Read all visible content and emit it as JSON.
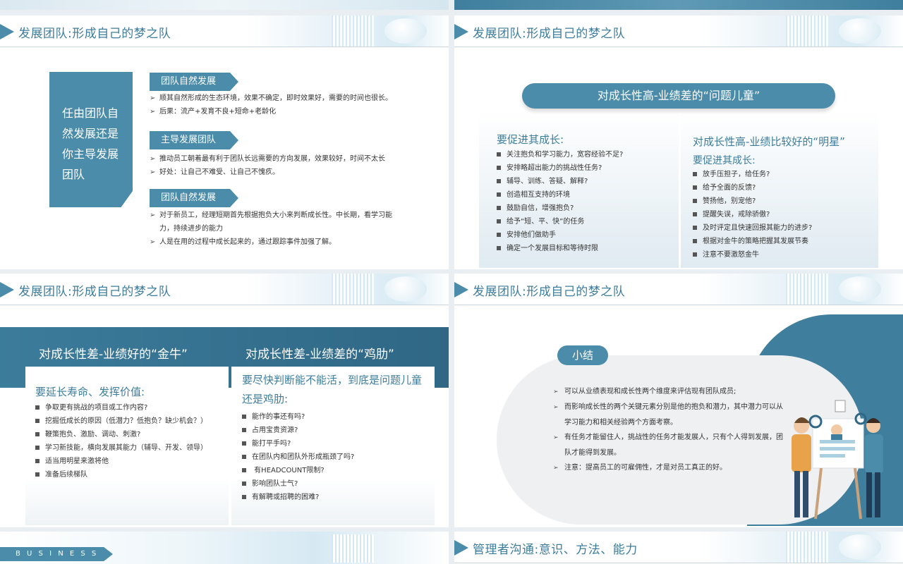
{
  "header_title": "发展团队:形成自己的梦之队",
  "slide1": {
    "left_box": "任由团队自然发展还是你主导发展团队",
    "sections": [
      {
        "tag": "团队自然发展",
        "bullets": [
          "顺其自然形成的生态环境，效果不确定，即时效果好，需要的时间也很长。",
          "后果：流产+发育不良+短命+老龄化"
        ]
      },
      {
        "tag": "主导发展团队",
        "bullets": [
          "推动员工朝着最有利于团队长远需要的方向发展，效果较好，时间不太长",
          "好处：让自己不难受、让自己不愧疚。"
        ]
      },
      {
        "tag": "团队自然发展",
        "bullets": [
          "对于新员工，经理短期首先根据抱负大小来判断成长性。中长期，看学习能力，持续进步的能力",
          "人是在用的过程中成长起来的，通过跟踪事件加强了解。"
        ]
      }
    ]
  },
  "slide2": {
    "pill": "对成长性高-业绩差的“问题儿童”",
    "left": {
      "sub": "要促进其成长:",
      "items": [
        "关注抱负和学习能力，宽容经验不足?",
        "安排略超出能力的挑战性任务?",
        "辅导、训练、答疑、解释?",
        "创造相互支持的环境",
        "鼓励自信，增强抱负?",
        "给予“短、平、快”的任务",
        "安排他们做助手",
        "确定一个发展目标和等待时限"
      ]
    },
    "right": {
      "title": "对成长性高-业绩比较好的“明星”",
      "sub": "要促进其成长:",
      "items": [
        "放手压担子，给任务?",
        "给予全面的反馈?",
        "赞扬他，别宠他?",
        "提醒失误，戒除骄傲?",
        "及时评定且快速回报其能力的进步?",
        "根据对金牛的策略把握其发展节奏",
        "注意不要激怒金牛"
      ]
    }
  },
  "slide3": {
    "left": {
      "title": "对成长性差-业绩好的“金牛”",
      "sub": "要延长寿命、发挥价值:",
      "items": [
        "争取更有挑战的项目或工作内容?",
        "挖掘低成长的原因（低潜力？低抱负？缺少机会？）",
        "鞭策抱负、激励、调动、刺激?",
        "学习新技能，横向发展其能力（辅导、开发、领导）",
        "适当用明星来激将他",
        "准备后续梯队"
      ]
    },
    "right": {
      "title": "对成长性差-业绩差的“鸡肋”",
      "sub": "要尽快判断能不能活，到底是问题儿童还是鸡肋:",
      "items": [
        "能作的事还有吗?",
        "占用宝贵资源?",
        "能打平手吗?",
        "在团队内和团队外形成瓶颈了吗?",
        " 有HEADCOUNT限制?",
        "影响团队士气?",
        "有解聘或招聘的困难?"
      ]
    }
  },
  "slide4": {
    "pill": "小结",
    "items": [
      "可以从业绩表现和成长性两个维度来评估现有团队成员;",
      "而影响成长性的两个关键元素分别是他的抱负和潜力，其中潜力可以从学习能力和相关经验两个方面考察。",
      "有任务才能留住人，挑战性的任务才能发展人，只有个人得到发展，团队才能得到发展。",
      "注意：提高员工的可雇佣性，才是对员工真正的好。"
    ]
  },
  "slide5": {
    "label": "B U S I N E S S"
  },
  "slide6": {
    "title": "管理者沟通:意识、方法、能力"
  },
  "colors": {
    "accent": "#4a8caa",
    "dark": "#2f6785"
  }
}
